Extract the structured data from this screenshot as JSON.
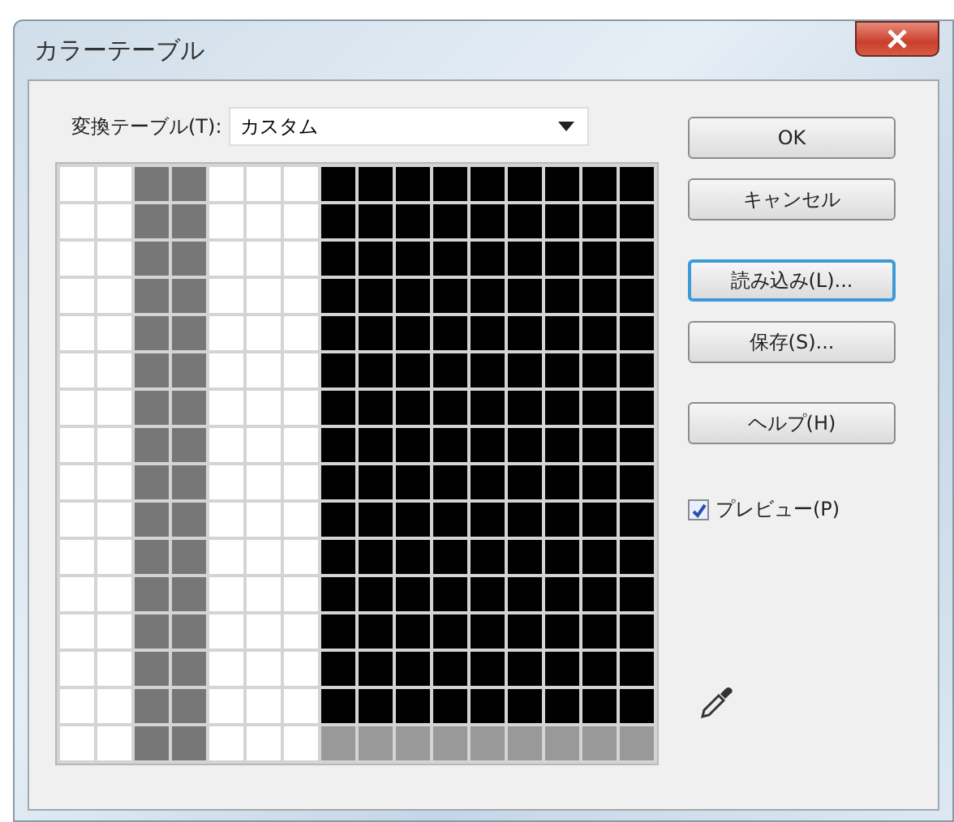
{
  "window": {
    "title": "カラーテーブル"
  },
  "table_select": {
    "label": "変換テーブル(T):",
    "value": "カスタム"
  },
  "swatch_rows": [
    {
      "cells": [
        {
          "color": "#ffffff"
        },
        {
          "color": "#ffffff"
        },
        {
          "color": "#777777"
        },
        {
          "color": "#777777"
        },
        {
          "color": "#ffffff"
        },
        {
          "color": "#ffffff"
        },
        {
          "color": "#ffffff"
        },
        {
          "color": "#000000"
        },
        {
          "color": "#000000"
        },
        {
          "color": "#000000"
        },
        {
          "color": "#000000"
        },
        {
          "color": "#000000"
        },
        {
          "color": "#000000"
        },
        {
          "color": "#000000"
        },
        {
          "color": "#000000"
        },
        {
          "color": "#000000"
        }
      ]
    },
    {
      "cells": [
        {
          "color": "#ffffff"
        },
        {
          "color": "#ffffff"
        },
        {
          "color": "#777777"
        },
        {
          "color": "#777777"
        },
        {
          "color": "#ffffff"
        },
        {
          "color": "#ffffff"
        },
        {
          "color": "#ffffff"
        },
        {
          "color": "#000000"
        },
        {
          "color": "#000000"
        },
        {
          "color": "#000000"
        },
        {
          "color": "#000000"
        },
        {
          "color": "#000000"
        },
        {
          "color": "#000000"
        },
        {
          "color": "#000000"
        },
        {
          "color": "#000000"
        },
        {
          "color": "#000000"
        }
      ]
    },
    {
      "cells": [
        {
          "color": "#ffffff"
        },
        {
          "color": "#ffffff"
        },
        {
          "color": "#777777"
        },
        {
          "color": "#777777"
        },
        {
          "color": "#ffffff"
        },
        {
          "color": "#ffffff"
        },
        {
          "color": "#ffffff"
        },
        {
          "color": "#000000"
        },
        {
          "color": "#000000"
        },
        {
          "color": "#000000"
        },
        {
          "color": "#000000"
        },
        {
          "color": "#000000"
        },
        {
          "color": "#000000"
        },
        {
          "color": "#000000"
        },
        {
          "color": "#000000"
        },
        {
          "color": "#000000"
        }
      ]
    },
    {
      "cells": [
        {
          "color": "#ffffff"
        },
        {
          "color": "#ffffff"
        },
        {
          "color": "#777777"
        },
        {
          "color": "#777777"
        },
        {
          "color": "#ffffff"
        },
        {
          "color": "#ffffff"
        },
        {
          "color": "#ffffff"
        },
        {
          "color": "#000000"
        },
        {
          "color": "#000000"
        },
        {
          "color": "#000000"
        },
        {
          "color": "#000000"
        },
        {
          "color": "#000000"
        },
        {
          "color": "#000000"
        },
        {
          "color": "#000000"
        },
        {
          "color": "#000000"
        },
        {
          "color": "#000000"
        }
      ]
    },
    {
      "cells": [
        {
          "color": "#ffffff"
        },
        {
          "color": "#ffffff"
        },
        {
          "color": "#777777"
        },
        {
          "color": "#777777"
        },
        {
          "color": "#ffffff"
        },
        {
          "color": "#ffffff"
        },
        {
          "color": "#ffffff"
        },
        {
          "color": "#000000"
        },
        {
          "color": "#000000"
        },
        {
          "color": "#000000"
        },
        {
          "color": "#000000"
        },
        {
          "color": "#000000"
        },
        {
          "color": "#000000"
        },
        {
          "color": "#000000"
        },
        {
          "color": "#000000"
        },
        {
          "color": "#000000"
        }
      ]
    },
    {
      "cells": [
        {
          "color": "#ffffff"
        },
        {
          "color": "#ffffff"
        },
        {
          "color": "#777777"
        },
        {
          "color": "#777777"
        },
        {
          "color": "#ffffff"
        },
        {
          "color": "#ffffff"
        },
        {
          "color": "#ffffff"
        },
        {
          "color": "#000000"
        },
        {
          "color": "#000000"
        },
        {
          "color": "#000000"
        },
        {
          "color": "#000000"
        },
        {
          "color": "#000000"
        },
        {
          "color": "#000000"
        },
        {
          "color": "#000000"
        },
        {
          "color": "#000000"
        },
        {
          "color": "#000000"
        }
      ]
    },
    {
      "cells": [
        {
          "color": "#ffffff"
        },
        {
          "color": "#ffffff"
        },
        {
          "color": "#777777"
        },
        {
          "color": "#777777"
        },
        {
          "color": "#ffffff"
        },
        {
          "color": "#ffffff"
        },
        {
          "color": "#ffffff"
        },
        {
          "color": "#000000"
        },
        {
          "color": "#000000"
        },
        {
          "color": "#000000"
        },
        {
          "color": "#000000"
        },
        {
          "color": "#000000"
        },
        {
          "color": "#000000"
        },
        {
          "color": "#000000"
        },
        {
          "color": "#000000"
        },
        {
          "color": "#000000"
        }
      ]
    },
    {
      "cells": [
        {
          "color": "#ffffff"
        },
        {
          "color": "#ffffff"
        },
        {
          "color": "#777777"
        },
        {
          "color": "#777777"
        },
        {
          "color": "#ffffff"
        },
        {
          "color": "#ffffff"
        },
        {
          "color": "#ffffff"
        },
        {
          "color": "#000000"
        },
        {
          "color": "#000000"
        },
        {
          "color": "#000000"
        },
        {
          "color": "#000000"
        },
        {
          "color": "#000000"
        },
        {
          "color": "#000000"
        },
        {
          "color": "#000000"
        },
        {
          "color": "#000000"
        },
        {
          "color": "#000000"
        }
      ]
    },
    {
      "cells": [
        {
          "color": "#ffffff"
        },
        {
          "color": "#ffffff"
        },
        {
          "color": "#777777"
        },
        {
          "color": "#777777"
        },
        {
          "color": "#ffffff"
        },
        {
          "color": "#ffffff"
        },
        {
          "color": "#ffffff"
        },
        {
          "color": "#000000"
        },
        {
          "color": "#000000"
        },
        {
          "color": "#000000"
        },
        {
          "color": "#000000"
        },
        {
          "color": "#000000"
        },
        {
          "color": "#000000"
        },
        {
          "color": "#000000"
        },
        {
          "color": "#000000"
        },
        {
          "color": "#000000"
        }
      ]
    },
    {
      "cells": [
        {
          "color": "#ffffff"
        },
        {
          "color": "#ffffff"
        },
        {
          "color": "#777777"
        },
        {
          "color": "#777777"
        },
        {
          "color": "#ffffff"
        },
        {
          "color": "#ffffff"
        },
        {
          "color": "#ffffff"
        },
        {
          "color": "#000000"
        },
        {
          "color": "#000000"
        },
        {
          "color": "#000000"
        },
        {
          "color": "#000000"
        },
        {
          "color": "#000000"
        },
        {
          "color": "#000000"
        },
        {
          "color": "#000000"
        },
        {
          "color": "#000000"
        },
        {
          "color": "#000000"
        }
      ]
    },
    {
      "cells": [
        {
          "color": "#ffffff"
        },
        {
          "color": "#ffffff"
        },
        {
          "color": "#777777"
        },
        {
          "color": "#777777"
        },
        {
          "color": "#ffffff"
        },
        {
          "color": "#ffffff"
        },
        {
          "color": "#ffffff"
        },
        {
          "color": "#000000"
        },
        {
          "color": "#000000"
        },
        {
          "color": "#000000"
        },
        {
          "color": "#000000"
        },
        {
          "color": "#000000"
        },
        {
          "color": "#000000"
        },
        {
          "color": "#000000"
        },
        {
          "color": "#000000"
        },
        {
          "color": "#000000"
        }
      ]
    },
    {
      "cells": [
        {
          "color": "#ffffff"
        },
        {
          "color": "#ffffff"
        },
        {
          "color": "#777777"
        },
        {
          "color": "#777777"
        },
        {
          "color": "#ffffff"
        },
        {
          "color": "#ffffff"
        },
        {
          "color": "#ffffff"
        },
        {
          "color": "#000000"
        },
        {
          "color": "#000000"
        },
        {
          "color": "#000000"
        },
        {
          "color": "#000000"
        },
        {
          "color": "#000000"
        },
        {
          "color": "#000000"
        },
        {
          "color": "#000000"
        },
        {
          "color": "#000000"
        },
        {
          "color": "#000000"
        }
      ]
    },
    {
      "cells": [
        {
          "color": "#ffffff"
        },
        {
          "color": "#ffffff"
        },
        {
          "color": "#777777"
        },
        {
          "color": "#777777"
        },
        {
          "color": "#ffffff"
        },
        {
          "color": "#ffffff"
        },
        {
          "color": "#ffffff"
        },
        {
          "color": "#000000"
        },
        {
          "color": "#000000"
        },
        {
          "color": "#000000"
        },
        {
          "color": "#000000"
        },
        {
          "color": "#000000"
        },
        {
          "color": "#000000"
        },
        {
          "color": "#000000"
        },
        {
          "color": "#000000"
        },
        {
          "color": "#000000"
        }
      ]
    },
    {
      "cells": [
        {
          "color": "#ffffff"
        },
        {
          "color": "#ffffff"
        },
        {
          "color": "#777777"
        },
        {
          "color": "#777777"
        },
        {
          "color": "#ffffff"
        },
        {
          "color": "#ffffff"
        },
        {
          "color": "#ffffff"
        },
        {
          "color": "#000000"
        },
        {
          "color": "#000000"
        },
        {
          "color": "#000000"
        },
        {
          "color": "#000000"
        },
        {
          "color": "#000000"
        },
        {
          "color": "#000000"
        },
        {
          "color": "#000000"
        },
        {
          "color": "#000000"
        },
        {
          "color": "#000000"
        }
      ]
    },
    {
      "cells": [
        {
          "color": "#ffffff"
        },
        {
          "color": "#ffffff"
        },
        {
          "color": "#777777"
        },
        {
          "color": "#777777"
        },
        {
          "color": "#ffffff"
        },
        {
          "color": "#ffffff"
        },
        {
          "color": "#ffffff"
        },
        {
          "color": "#000000"
        },
        {
          "color": "#000000"
        },
        {
          "color": "#000000"
        },
        {
          "color": "#000000"
        },
        {
          "color": "#000000"
        },
        {
          "color": "#000000"
        },
        {
          "color": "#000000"
        },
        {
          "color": "#000000"
        },
        {
          "color": "#000000"
        }
      ]
    },
    {
      "cells": [
        {
          "color": "#ffffff"
        },
        {
          "color": "#ffffff"
        },
        {
          "color": "#777777"
        },
        {
          "color": "#777777"
        },
        {
          "color": "#ffffff"
        },
        {
          "color": "#ffffff"
        },
        {
          "color": "#ffffff"
        },
        {
          "color": "#999999"
        },
        {
          "color": "#999999"
        },
        {
          "color": "#999999"
        },
        {
          "color": "#999999"
        },
        {
          "color": "#999999"
        },
        {
          "color": "#999999"
        },
        {
          "color": "#999999"
        },
        {
          "color": "#999999"
        },
        {
          "color": "#999999"
        }
      ]
    }
  ],
  "button_groups": [
    [
      {
        "label": "OK",
        "focused": false
      },
      {
        "label": "キャンセル",
        "focused": false
      }
    ],
    [
      {
        "label": "読み込み(L)...",
        "focused": true
      },
      {
        "label": "保存(S)...",
        "focused": false
      }
    ],
    [
      {
        "label": "ヘルプ(H)",
        "focused": false
      }
    ]
  ],
  "preview": {
    "label": "プレビュー(P)",
    "checked": true
  }
}
